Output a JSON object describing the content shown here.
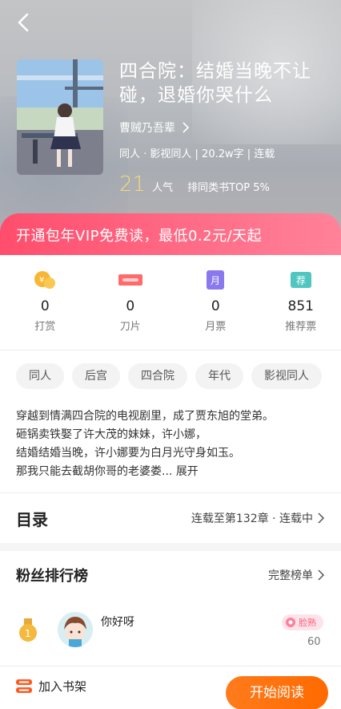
{
  "book": {
    "title": "四合院：结婚当晚不让碰，退婚你哭什么",
    "author": "曹贼乃吾辈",
    "meta": "同人 · 影视同人 | 20.2w字 | 连载",
    "popularity_value": "21",
    "popularity_label": "人气",
    "rank_text": "排同类书TOP 5%"
  },
  "vip_banner": "开通包年VIP免费读，最低0.2元/天起",
  "stats": [
    {
      "value": "0",
      "label": "打赏",
      "icon": "coin-icon"
    },
    {
      "value": "0",
      "label": "刀片",
      "icon": "blade-icon"
    },
    {
      "value": "0",
      "label": "月票",
      "icon": "monthly-ticket-icon"
    },
    {
      "value": "851",
      "label": "推荐票",
      "icon": "recommend-ticket-icon"
    }
  ],
  "stat_icon_texts": {
    "monthly": "月",
    "recommend": "荐"
  },
  "tags": [
    "同人",
    "后宫",
    "四合院",
    "年代",
    "影视同人"
  ],
  "description": {
    "line1": "穿越到情满四合院的电视剧里，成了贾东旭的堂弟。",
    "line2": "砸锅卖铁娶了许大茂的妹妹，许小娜，",
    "line3": "结婚结婚当晚，许小娜要为白月光守身如玉。",
    "line4": "那我只能去截胡你哥的老婆娄...",
    "expand": "展开"
  },
  "catalog": {
    "title": "目录",
    "status": "连载至第132章 · 连载中"
  },
  "fans": {
    "title": "粉丝排行榜",
    "full_list": "完整榜单",
    "top": {
      "rank": "1",
      "name": "你好呀",
      "badge": "脸熟",
      "score": "60"
    }
  },
  "bottom": {
    "shelf": "加入书架",
    "read": "开始阅读"
  },
  "colors": {
    "vip_start": "#ff4d6d",
    "read_button": "#ff6a00",
    "popularity": "#f5dc78"
  }
}
